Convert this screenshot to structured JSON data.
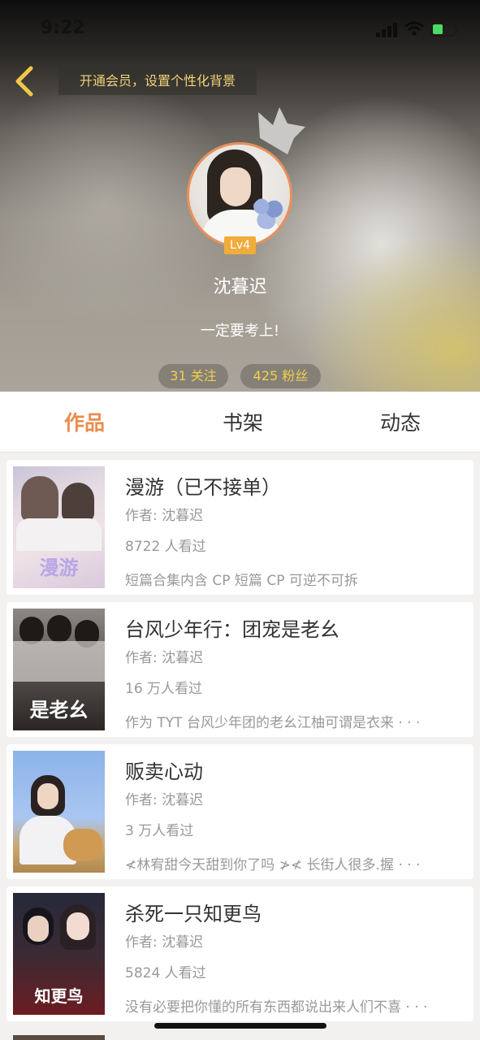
{
  "status_bar": {
    "time": "9:22"
  },
  "header": {
    "back_icon": "chevron-left-icon",
    "banner_text": "开通会员，设置个性化背景",
    "level_badge": "Lv4",
    "username": "沈暮迟",
    "bio": "一定要考上!",
    "following_label": "31 关注",
    "fans_label": "425 粉丝"
  },
  "tabs": [
    {
      "label": "作品",
      "active": true
    },
    {
      "label": "书架",
      "active": false
    },
    {
      "label": "动态",
      "active": false
    }
  ],
  "works": [
    {
      "title": "漫游（已不接单）",
      "author": "作者: 沈暮迟",
      "views": "8722 人看过",
      "desc": "短篇合集内含 CP 短篇 CP 可逆不可拆",
      "cover_text": "漫游"
    },
    {
      "title": "台风少年行：团宠是老幺",
      "author": "作者: 沈暮迟",
      "views": "16 万人看过",
      "desc": "作为 TYT 台风少年团的老幺江柚可谓是衣来 · · ·",
      "cover_text": "是老幺"
    },
    {
      "title": "贩卖心动",
      "author": "作者: 沈暮迟",
      "views": "3 万人看过",
      "desc": "≮林宥甜今天甜到你了吗 ≯≮ 长街人很多.握 · · ·",
      "cover_text": ""
    },
    {
      "title": "杀死一只知更鸟",
      "author": "作者: 沈暮迟",
      "views": "5824 人看过",
      "desc": "没有必要把你懂的所有东西都说出来人们不喜 · · ·",
      "cover_text": "知更鸟"
    }
  ],
  "colors": {
    "accent": "#e88d4c",
    "level_badge": "#f0ac3c",
    "banner_text": "#f2d27a",
    "stat_text": "#f3cf4a"
  }
}
